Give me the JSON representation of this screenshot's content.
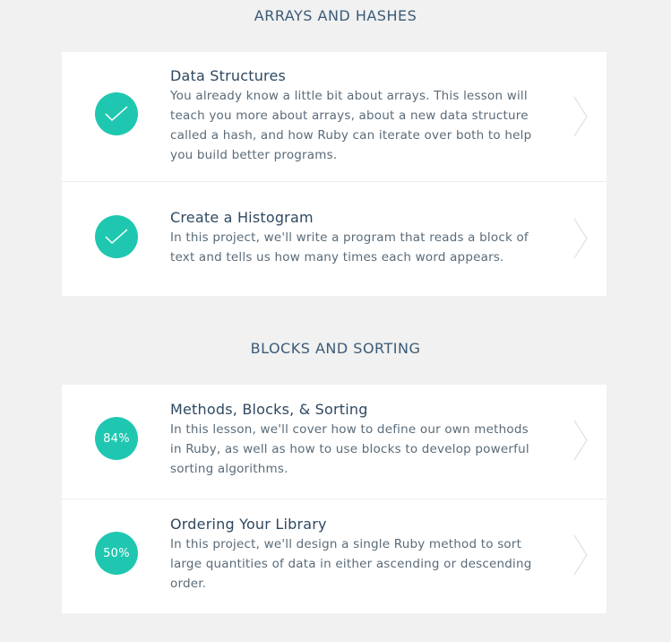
{
  "sections": [
    {
      "title": "ARRAYS AND HASHES",
      "items": [
        {
          "status": "complete",
          "title": "Data Structures",
          "description": "You already know a little bit about arrays. This lesson will teach you more about arrays, about a new data structure called a hash, and how Ruby can iterate over both to help you build better programs."
        },
        {
          "status": "complete",
          "title": "Create a Histogram",
          "description": "In this project, we'll write a program that reads a block of text and tells us how many times each word appears."
        }
      ]
    },
    {
      "title": "BLOCKS AND SORTING",
      "items": [
        {
          "status": "in-progress",
          "progress_label": "84%",
          "progress": 0.84,
          "title": "Methods, Blocks, & Sorting",
          "description": "In this lesson, we'll cover how to define our own methods in Ruby, as well as how to use blocks to develop powerful sorting algorithms."
        },
        {
          "status": "in-progress",
          "progress_label": "50%",
          "progress": 0.5,
          "title": "Ordering Your Library",
          "description": "In this project, we'll design a single Ruby method to sort large quantities of data in either ascending or descending order."
        }
      ]
    }
  ],
  "colors": {
    "accent": "#1fc7b0",
    "background": "#f0f1f0",
    "card": "#ffffff",
    "title_text": "#2f4860"
  },
  "icons": {
    "complete": "checkmark-icon",
    "navigate": "chevron-right-icon"
  }
}
